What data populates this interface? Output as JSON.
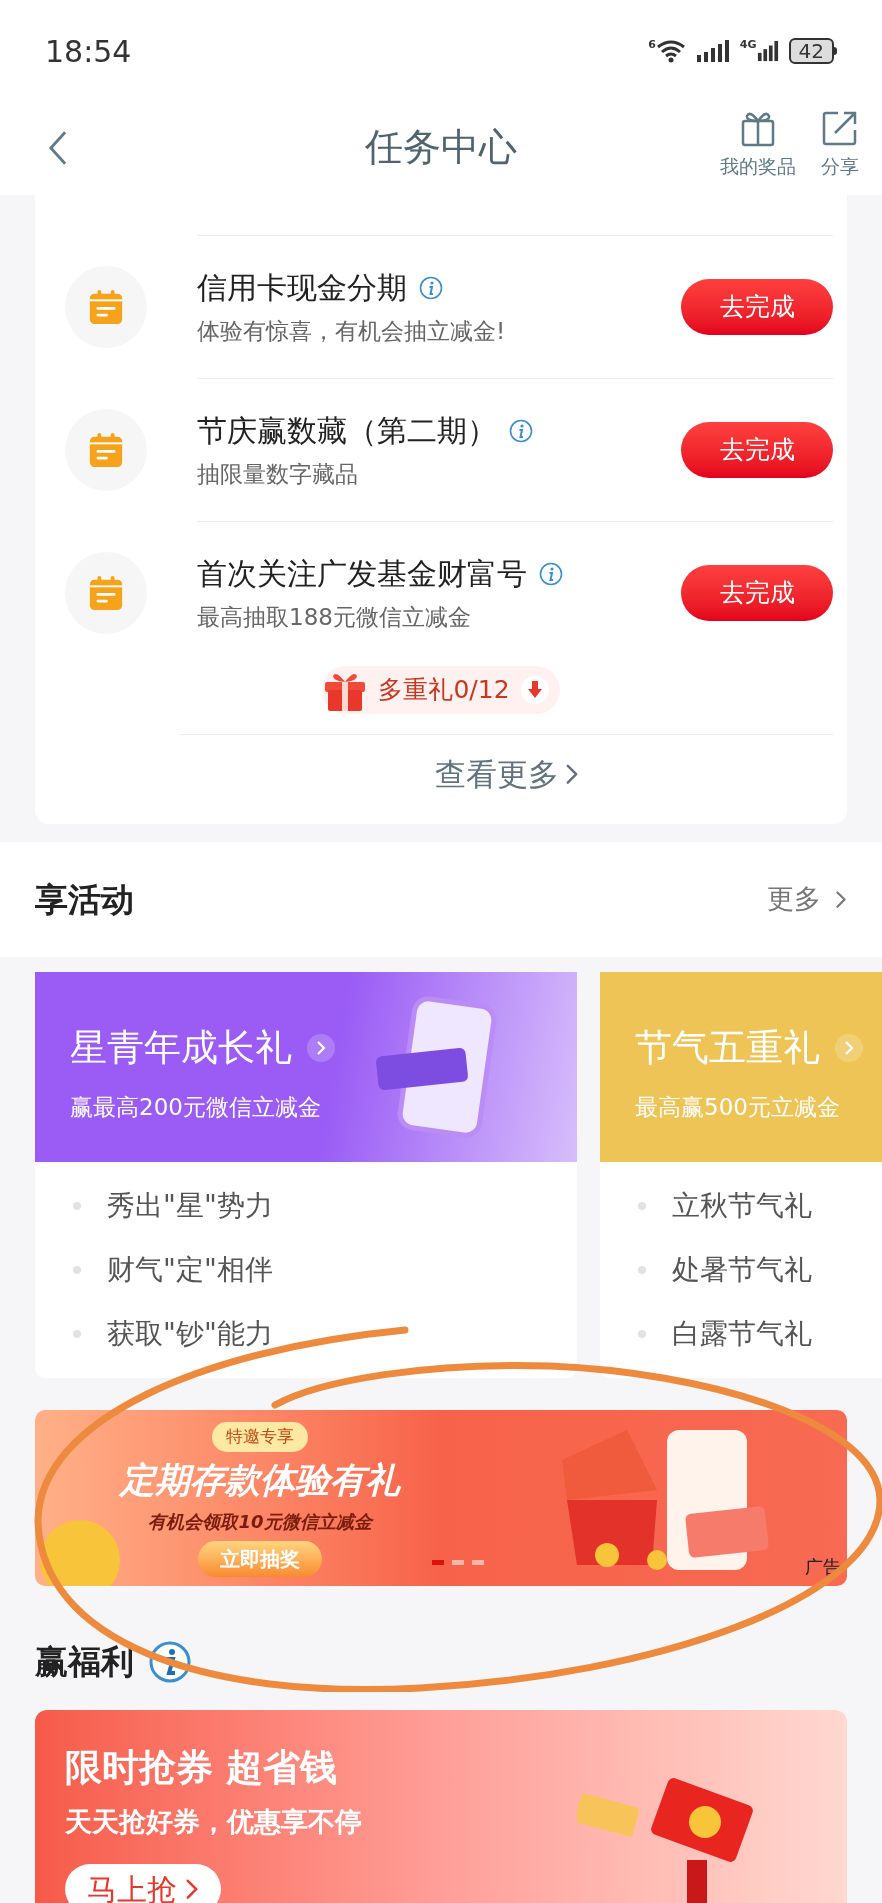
{
  "status_bar": {
    "time": "18:54",
    "wifi_label": "6",
    "network": "4G",
    "battery": "42"
  },
  "header": {
    "title": "任务中心",
    "actions": [
      {
        "kind": "gift",
        "label": "我的奖品"
      },
      {
        "kind": "share",
        "label": "分享"
      }
    ]
  },
  "tasks": [
    {
      "title": "信用卡现金分期",
      "subtitle": "体验有惊喜，有机会抽立减金!",
      "button": "去完成"
    },
    {
      "title": "节庆赢数藏（第二期）",
      "subtitle": "抽限量数字藏品",
      "button": "去完成"
    },
    {
      "title": "首次关注广发基金财富号",
      "subtitle": "最高抽取188元微信立减金",
      "button": "去完成"
    }
  ],
  "multi_gift": {
    "label": "多重礼0/12"
  },
  "see_more": "查看更多",
  "activities": {
    "title": "享活动",
    "more": "更多",
    "cards": [
      {
        "title": "星青年成长礼",
        "subtitle": "赢最高200元微信立减金",
        "color": "#9a5cf5",
        "items": [
          "秀出\"星\"势力",
          "财气\"定\"相伴",
          "获取\"钞\"能力"
        ]
      },
      {
        "title": "节气五重礼",
        "subtitle": "最高赢500元立减金",
        "color": "#eec456",
        "items": [
          "立秋节气礼",
          "处暑节气礼",
          "白露节气礼"
        ]
      }
    ]
  },
  "ad_banner": {
    "tag": "特邀专享",
    "title": "定期存款体验有礼",
    "subtitle": "有机会领取**10**元微信立减金",
    "button": "立即抽奖",
    "badge": "广告",
    "dots": [
      {
        "selected": true
      },
      {
        "selected": false
      },
      {
        "selected": false
      }
    ]
  },
  "welfare": {
    "title": "赢福利",
    "banner": {
      "title": "限时抢券 超省钱",
      "subtitle": "天天抢好券，优惠享不停",
      "button": "马上抢"
    }
  }
}
